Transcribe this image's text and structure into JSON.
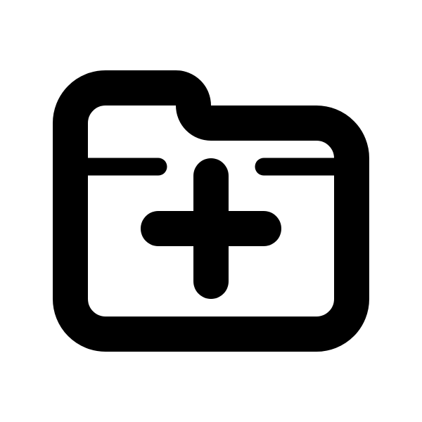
{
  "icon": {
    "name": "folder-add-icon",
    "colors": {
      "stroke": "#000000",
      "background": "#ffffff"
    }
  }
}
